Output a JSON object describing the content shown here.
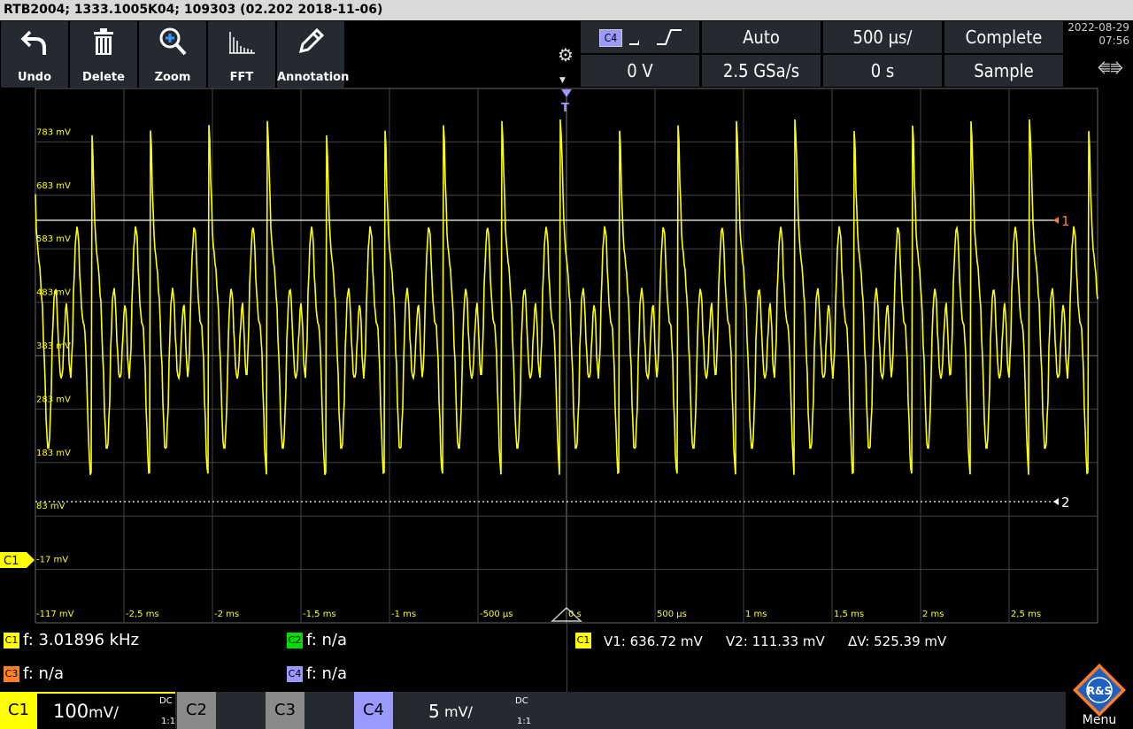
{
  "title": "RTB2004; 1333.1005K04; 109303 (02.202 2018-11-06)",
  "toolbar": {
    "undo": "Undo",
    "delete": "Delete",
    "zoom": "Zoom",
    "fft": "FFT",
    "annotation": "Annotation"
  },
  "header": {
    "channel_chip": "C4",
    "trigger_mode": "Auto",
    "timebase": "500 µs/",
    "acq_state": "Complete",
    "trigger_level": "0 V",
    "sample_rate": "2.5 GSa/s",
    "position": "0 s",
    "acq_mode": "Sample",
    "date": "2022-08-29",
    "time": "07:56"
  },
  "waveform": {
    "y_labels": [
      "783 mV",
      "683 mV",
      "583 mV",
      "483 mV",
      "383 mV",
      "283 mV",
      "183 mV",
      "83 mV",
      "-17 mV",
      "-117 mV"
    ],
    "x_labels": [
      "-2,5 ms",
      "-2 ms",
      "-1,5 ms",
      "-1 ms",
      "-500 µs",
      "0 s",
      "500 µs",
      "1 ms",
      "1,5 ms",
      "2 ms",
      "2,5 ms"
    ],
    "cursor1_label": "1",
    "cursor2_label": "2",
    "channel_marker": "C1",
    "trigger_marker": "T",
    "trace_color": "#ffff00"
  },
  "measurements": {
    "c1_chip": "C1",
    "c1": "f: 3.01896 kHz",
    "c2_chip": "C2",
    "c2": "f: n/a",
    "c3_chip": "C3",
    "c3": "f: n/a",
    "c4_chip": "C4",
    "c4": "f: n/a",
    "cursor_chip": "C1",
    "v1": "V1: 636.72 mV",
    "v2": "V2: 111.33 mV",
    "dv": "ΔV: 525.39 mV"
  },
  "channels": {
    "c1_label": "C1",
    "c1_scale_num": "100",
    "c1_scale_unit": "mV/",
    "c1_coupling": "DC",
    "c1_ratio": "1:1",
    "c2_label": "C2",
    "c3_label": "C3",
    "c4_label": "C4",
    "c4_scale_num": "5",
    "c4_scale_unit": "mV/",
    "c4_coupling": "DC",
    "c4_ratio": "1:1",
    "menu_label": "Menu",
    "logo_text": "R&S"
  },
  "colors": {
    "c1": "#ffff00",
    "c2": "#00dd00",
    "c3": "#ff7f27",
    "c4": "#9999ff",
    "cursor1": "#ff7f27"
  }
}
